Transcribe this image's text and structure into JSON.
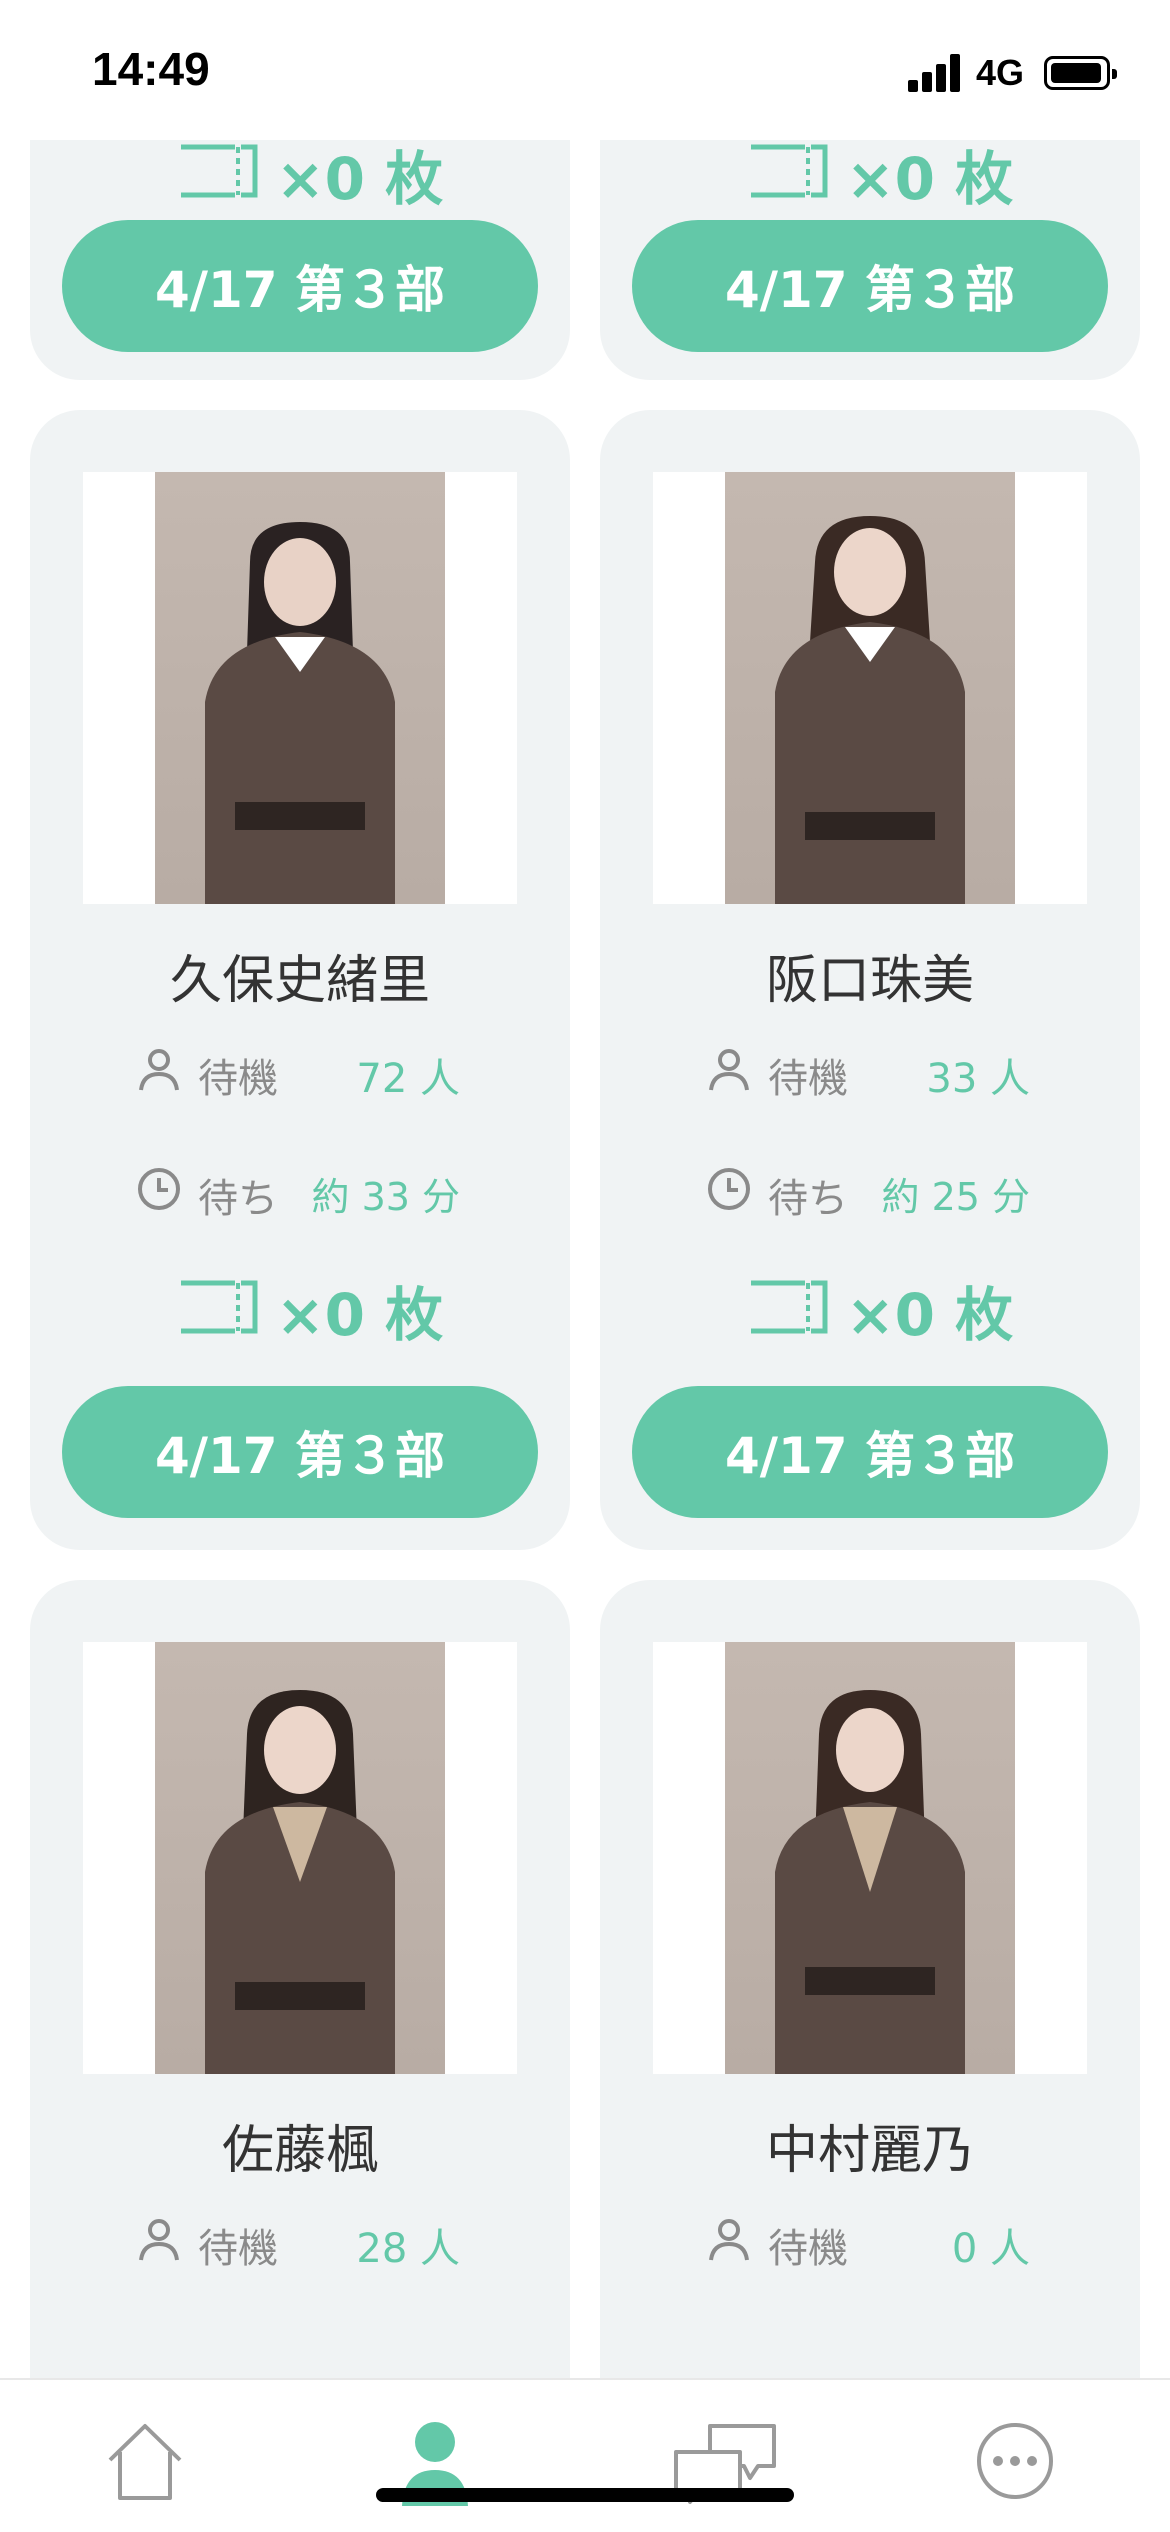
{
  "status_bar": {
    "time": "14:49",
    "network": "4G"
  },
  "cards": [
    {
      "slot": "top-left",
      "tickets": "×0 枚",
      "session_button": "4/17 第３部"
    },
    {
      "slot": "top-right",
      "tickets": "×0 枚",
      "session_button": "4/17 第３部"
    },
    {
      "slot": "middle-left",
      "name": "久保史緒里",
      "waiting_label": "待機",
      "waiting_count": "72 人",
      "wait_time_label": "待ち",
      "wait_time": "約 33 分",
      "tickets": "×0 枚",
      "session_button": "4/17 第３部"
    },
    {
      "slot": "middle-right",
      "name": "阪口珠美",
      "waiting_label": "待機",
      "waiting_count": "33 人",
      "wait_time_label": "待ち",
      "wait_time": "約 25 分",
      "tickets": "×0 枚",
      "session_button": "4/17 第３部"
    },
    {
      "slot": "bottom-left",
      "name": "佐藤楓",
      "waiting_label": "待機",
      "waiting_count": "28 人"
    },
    {
      "slot": "bottom-right",
      "name": "中村麗乃",
      "waiting_label": "待機",
      "waiting_count": "0 人"
    }
  ],
  "tab_bar": {
    "tabs": [
      {
        "icon": "home-icon",
        "selected": false
      },
      {
        "icon": "person-icon",
        "selected": true
      },
      {
        "icon": "chat-icon",
        "selected": false
      },
      {
        "icon": "more-icon",
        "selected": false
      }
    ]
  },
  "colors": {
    "accent": "#63c8a8",
    "card_bg": "#f0f3f4",
    "muted_text": "#8a8a8a",
    "text": "#333333"
  }
}
